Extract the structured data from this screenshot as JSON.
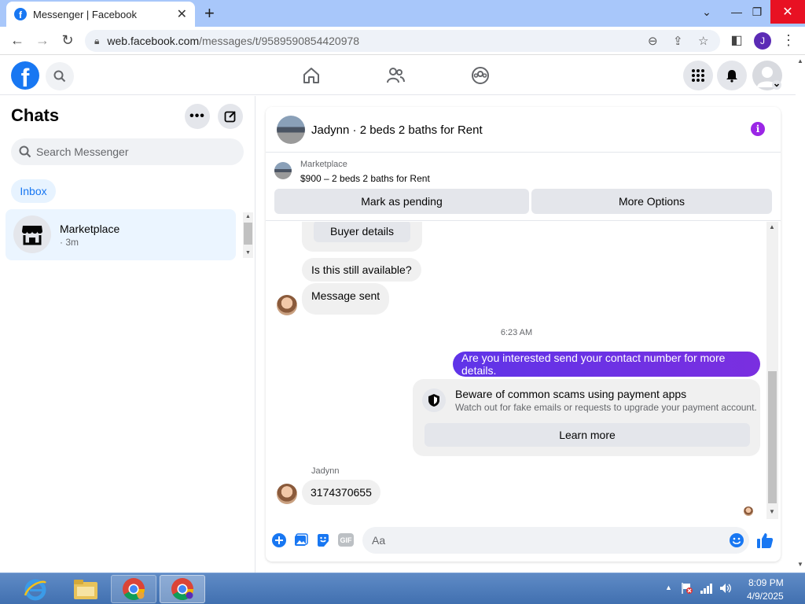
{
  "browser": {
    "tab_title": "Messenger | Facebook",
    "url_domain": "web.facebook.com",
    "url_path": "/messages/t/9589590854420978",
    "profile_initial": "J"
  },
  "sidebar": {
    "title": "Chats",
    "search_placeholder": "Search Messenger",
    "inbox_tab": "Inbox",
    "chat": {
      "name": "Marketplace",
      "time": "· 3m"
    }
  },
  "conversation": {
    "title": "Jadynn · 2 beds 2 baths for Rent",
    "listing_source": "Marketplace",
    "listing_desc": "$900 – 2 beds 2 baths for Rent",
    "mark_pending_label": "Mark as pending",
    "more_options_label": "More Options",
    "messages": {
      "buyer_details": "Buyer details",
      "still_available": "Is this still available?",
      "message_sent": "Message sent",
      "timestamp": "6:23 AM",
      "outgoing": "Are you interested send your contact number for more details.",
      "scam_title": "Beware of common scams using payment apps",
      "scam_desc": "Watch out for fake emails or requests to upgrade your payment account.",
      "learn_more": "Learn more",
      "sender_name": "Jadynn",
      "phone": "3174370655"
    },
    "composer_placeholder": "Aa",
    "gif_label": "GIF"
  },
  "taskbar": {
    "time": "8:09 PM",
    "date": "4/9/2025"
  },
  "colors": {
    "fb_blue": "#1877f2",
    "outgoing_bubble": "#6a2ee8",
    "info_purple": "#9b26e6"
  }
}
